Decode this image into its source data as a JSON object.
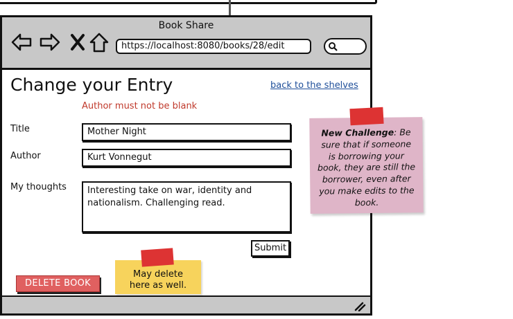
{
  "window": {
    "title": "Book Share",
    "url": "https://localhost:8080/books/28/edit"
  },
  "icons": {
    "back": "back-arrow-icon",
    "forward": "forward-arrow-icon",
    "close": "close-icon",
    "home": "home-icon",
    "search": "search-icon",
    "resize": "resize-grip-icon"
  },
  "page": {
    "title": "Change your Entry",
    "back_link": "back to the shelves",
    "error": "Author must not be blank"
  },
  "form": {
    "title_label": "Title",
    "title_value": "Mother Night",
    "author_label": "Author",
    "author_value": "Kurt Vonnegut",
    "thoughts_label": "My thoughts",
    "thoughts_line1": "Interesting take on war, identity and",
    "thoughts_line2": "nationalism. Challenging read.",
    "submit_label": "Submit",
    "delete_label": "DELETE BOOK"
  },
  "notes": {
    "delete_note_line1": "May delete",
    "delete_note_line2": "here as well.",
    "challenge_heading": "New Challenge",
    "challenge_lines": [
      ": Be",
      "sure that if someone",
      "is borrowing your",
      "book, they are still the",
      "borrower, even after",
      "you make edits to the",
      "book."
    ]
  },
  "colors": {
    "chrome": "#c8c8c8",
    "error": "#c0392b",
    "link": "#1f4f9a",
    "delete_button": "#e06060",
    "yellow_note": "#f7d35c",
    "pink_note": "#dfb5c8",
    "tape": "#dd3333"
  }
}
